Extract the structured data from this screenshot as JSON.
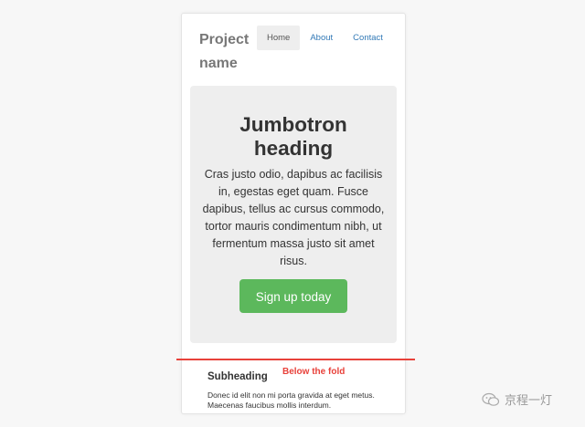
{
  "navbar": {
    "brand": "Project name",
    "links": [
      {
        "label": "Home",
        "active": true
      },
      {
        "label": "About",
        "active": false
      },
      {
        "label": "Contact",
        "active": false
      }
    ]
  },
  "jumbotron": {
    "heading": "Jumbotron heading",
    "text": "Cras justo odio, dapibus ac facilisis in, egestas eget quam. Fusce dapibus, tellus ac cursus commodo, tortor mauris condimentum nibh, ut fermentum massa justo sit amet risus.",
    "button_label": "Sign up today"
  },
  "content": {
    "subheading": "Subheading",
    "text": "Donec id elit non mi porta gravida at eget metus. Maecenas faucibus mollis interdum."
  },
  "annotation": {
    "fold_label": "Below the fold"
  },
  "watermark": {
    "text": "京程一灯"
  },
  "colors": {
    "accent_button": "#5cb85c",
    "link": "#337ab7",
    "fold_marker": "#e8413a"
  }
}
